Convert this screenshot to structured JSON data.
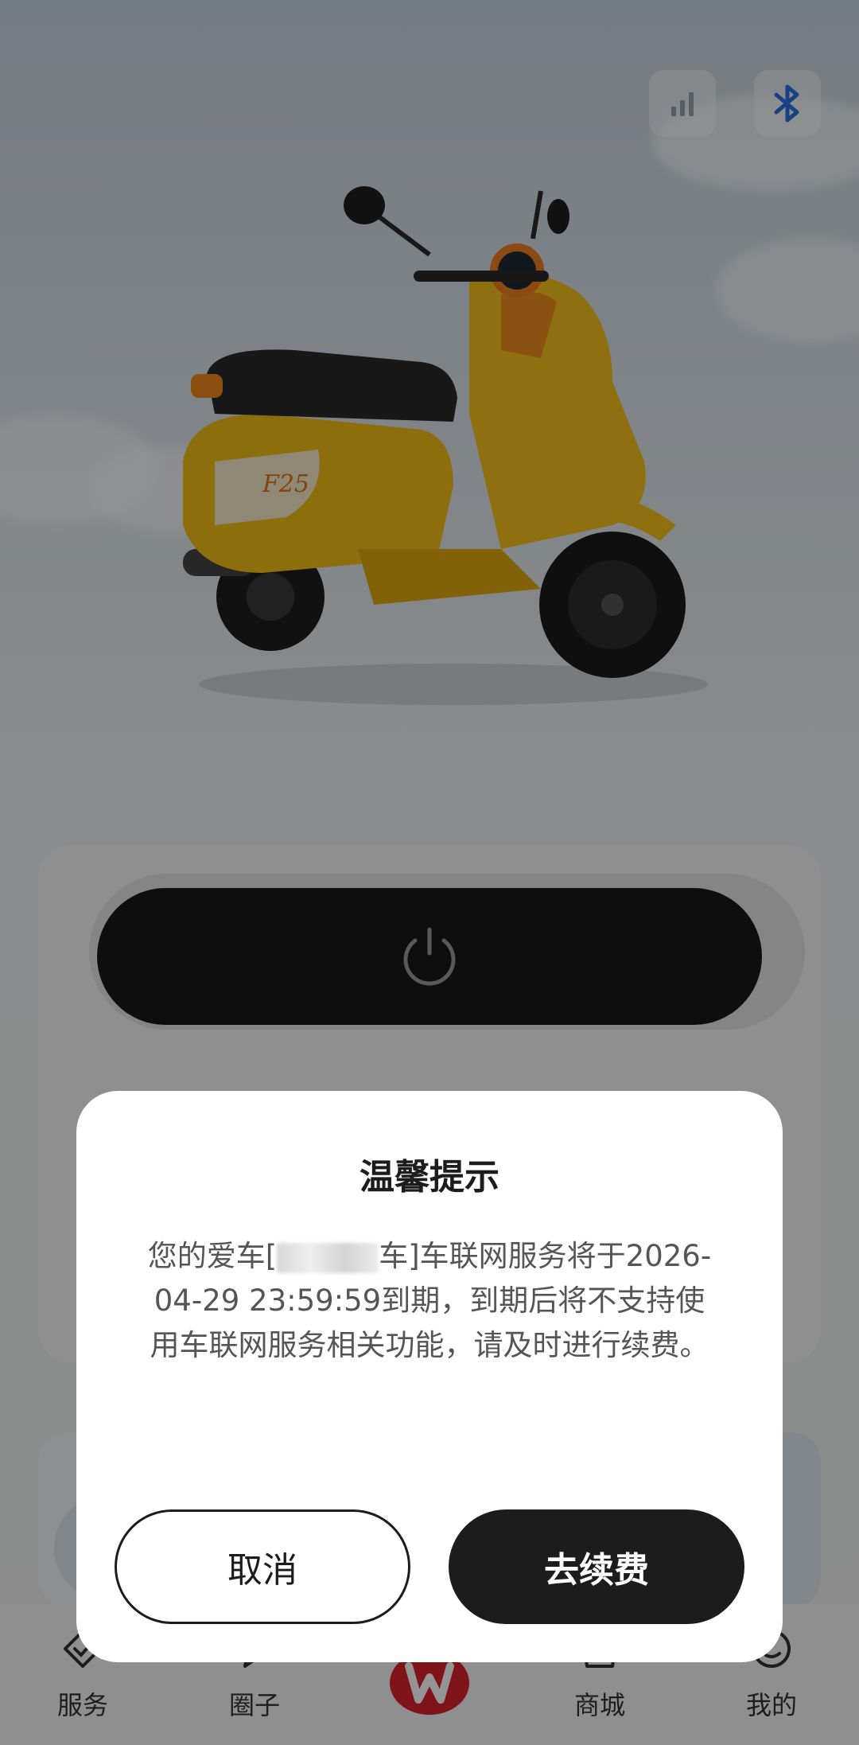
{
  "top_bar": {
    "signal_icon": "signal-bars-icon",
    "bluetooth_icon": "bluetooth-icon"
  },
  "vehicle": {
    "image": "yellow-scooter",
    "badge_text": "F25"
  },
  "control": {
    "power_icon": "power-icon"
  },
  "bottom_nav": {
    "items": [
      {
        "label": "服务",
        "icon": "service-icon"
      },
      {
        "label": "圈子",
        "icon": "community-icon"
      },
      {
        "label": "商城",
        "icon": "shop-icon"
      },
      {
        "label": "我的",
        "icon": "profile-icon"
      }
    ],
    "center_icon": "brand-logo-icon"
  },
  "dialog": {
    "title": "温馨提示",
    "body_prefix": "您的爱车[",
    "body_suffix": "车]车联网服务将于2026-04-29 23:59:59到期，到期后将不支持使用车联网服务相关功能，请及时进行续费。",
    "cancel_label": "取消",
    "renew_label": "去续费"
  },
  "colors": {
    "accent_dark": "#1c1c1c",
    "bluetooth_blue": "#2a6fe0",
    "brand_red": "#d9232d",
    "scooter_yellow": "#f3c01a"
  }
}
